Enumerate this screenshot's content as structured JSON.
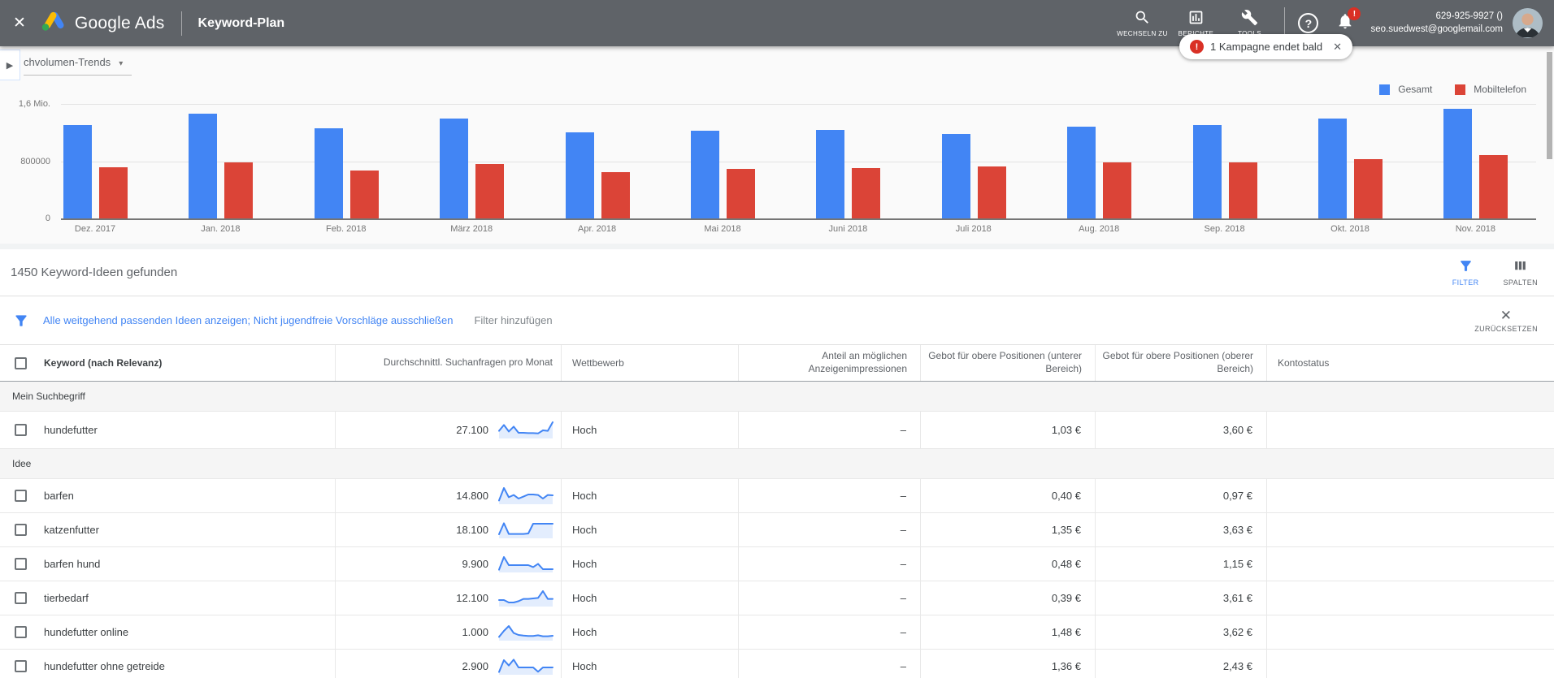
{
  "icons": {
    "close": "✕",
    "arrow_down": "▾",
    "panel_toggle": "▶",
    "help": "?"
  },
  "colors": {
    "blue": "#4285f4",
    "red": "#db4437",
    "link": "#4285f4"
  },
  "topbar": {
    "brand": "Google Ads",
    "page_title": "Keyword-Plan",
    "nav": [
      {
        "id": "wechseln-zu",
        "label": "WECHSELN ZU"
      },
      {
        "id": "berichte",
        "label": "BERICHTE"
      },
      {
        "id": "tools",
        "label": "TOOLS"
      }
    ],
    "notification_badge": "!",
    "account": {
      "phone": "629-925-9927 ()",
      "email": "seo.suedwest@googlemail.com"
    }
  },
  "toast": {
    "badge": "!",
    "text": "1 Kampagne endet bald"
  },
  "chart": {
    "dropdown_label": "chvolumen-Trends",
    "chart_data": {
      "type": "bar",
      "title": "Suchvolumen-Trends",
      "categories": [
        "Dez. 2017",
        "Jan. 2018",
        "Feb. 2018",
        "März 2018",
        "Apr. 2018",
        "Mai 2018",
        "Juni 2018",
        "Juli 2018",
        "Aug. 2018",
        "Sep. 2018",
        "Okt. 2018",
        "Nov. 2018"
      ],
      "series": [
        {
          "name": "Gesamt",
          "color": "#4285f4",
          "values": [
            1300000,
            1460000,
            1260000,
            1400000,
            1200000,
            1230000,
            1240000,
            1180000,
            1280000,
            1310000,
            1400000,
            1530000
          ]
        },
        {
          "name": "Mobiltelefon",
          "color": "#db4437",
          "values": [
            720000,
            780000,
            670000,
            760000,
            650000,
            690000,
            700000,
            730000,
            780000,
            780000,
            830000,
            890000
          ]
        }
      ],
      "ylim": [
        0,
        1600000
      ],
      "yticks": [
        {
          "value": 0,
          "label": "0"
        },
        {
          "value": 800000,
          "label": "800000"
        },
        {
          "value": 1600000,
          "label": "1,6 Mio."
        }
      ],
      "grid": true,
      "legend_position": "top-right"
    }
  },
  "results": {
    "count": "1450 Keyword-Ideen gefunden",
    "filter_label": "FILTER",
    "columns_label": "SPALTEN"
  },
  "filter_bar": {
    "applied": "Alle weitgehend passenden Ideen anzeigen; Nicht jugendfreie Vorschläge ausschließen",
    "add": "Filter hinzufügen",
    "reset": "ZURÜCKSETZEN"
  },
  "table": {
    "headers": [
      {
        "label": "Keyword (nach Relevanz)",
        "align": "left"
      },
      {
        "label": "Durchschnittl. Suchanfragen pro Monat",
        "align": "right"
      },
      {
        "label": "Wettbewerb",
        "align": "left"
      },
      {
        "label": "Anteil an möglichen Anzeigenimpressionen",
        "align": "right"
      },
      {
        "label": "Gebot für obere Positionen (unterer Bereich)",
        "align": "right"
      },
      {
        "label": "Gebot für obere Positionen (oberer Bereich)",
        "align": "right"
      },
      {
        "label": "Kontostatus",
        "align": "left"
      }
    ],
    "sections": [
      {
        "label": "Mein Suchbegriff",
        "rows": [
          {
            "keyword": "hundefutter",
            "avg_monthly_searches": "27.100",
            "trend": [
              0.42,
              0.78,
              0.38,
              0.68,
              0.3,
              0.3,
              0.28,
              0.28,
              0.26,
              0.45,
              0.42,
              0.95
            ],
            "competition": "Hoch",
            "impression_share": "–",
            "top_bid_low": "1,03 €",
            "top_bid_high": "3,60 €",
            "account_status": ""
          }
        ]
      },
      {
        "label": "Idee",
        "rows": [
          {
            "keyword": "barfen",
            "avg_monthly_searches": "14.800",
            "trend": [
              0.18,
              0.95,
              0.38,
              0.52,
              0.3,
              0.42,
              0.55,
              0.55,
              0.52,
              0.3,
              0.52,
              0.5
            ],
            "competition": "Hoch",
            "impression_share": "–",
            "top_bid_low": "0,40 €",
            "top_bid_high": "0,97 €",
            "account_status": ""
          },
          {
            "keyword": "katzenfutter",
            "avg_monthly_searches": "18.100",
            "trend": [
              0.2,
              0.88,
              0.22,
              0.22,
              0.22,
              0.22,
              0.25,
              0.85,
              0.85,
              0.85,
              0.85,
              0.85
            ],
            "competition": "Hoch",
            "impression_share": "–",
            "top_bid_low": "1,35 €",
            "top_bid_high": "3,63 €",
            "account_status": ""
          },
          {
            "keyword": "barfen hund",
            "avg_monthly_searches": "9.900",
            "trend": [
              0.12,
              0.9,
              0.4,
              0.4,
              0.4,
              0.4,
              0.4,
              0.28,
              0.48,
              0.15,
              0.15,
              0.15
            ],
            "competition": "Hoch",
            "impression_share": "–",
            "top_bid_low": "0,48 €",
            "top_bid_high": "1,15 €",
            "account_status": ""
          },
          {
            "keyword": "tierbedarf",
            "avg_monthly_searches": "12.100",
            "trend": [
              0.35,
              0.35,
              0.2,
              0.2,
              0.28,
              0.42,
              0.42,
              0.45,
              0.48,
              0.9,
              0.42,
              0.42
            ],
            "competition": "Hoch",
            "impression_share": "–",
            "top_bid_low": "0,39 €",
            "top_bid_high": "3,61 €",
            "account_status": ""
          },
          {
            "keyword": "hundefutter online",
            "avg_monthly_searches": "1.000",
            "trend": [
              0.18,
              0.55,
              0.85,
              0.42,
              0.3,
              0.26,
              0.24,
              0.24,
              0.28,
              0.22,
              0.22,
              0.25
            ],
            "competition": "Hoch",
            "impression_share": "–",
            "top_bid_low": "1,48 €",
            "top_bid_high": "3,62 €",
            "account_status": ""
          },
          {
            "keyword": "hundefutter ohne getreide",
            "avg_monthly_searches": "2.900",
            "trend": [
              0.12,
              0.85,
              0.52,
              0.88,
              0.4,
              0.4,
              0.4,
              0.4,
              0.14,
              0.4,
              0.4,
              0.4
            ],
            "competition": "Hoch",
            "impression_share": "–",
            "top_bid_low": "1,36 €",
            "top_bid_high": "2,43 €",
            "account_status": ""
          }
        ]
      }
    ]
  }
}
